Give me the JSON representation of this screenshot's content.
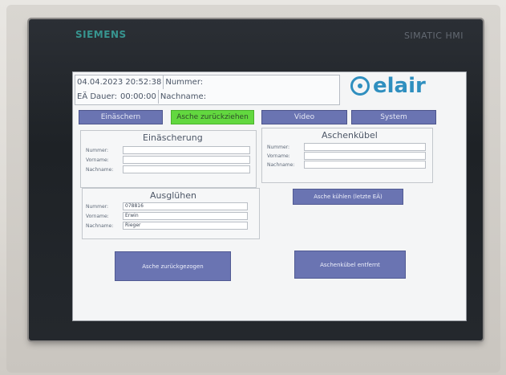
{
  "hmi": {
    "brand_left": "SIEMENS",
    "brand_right": "SIMATIC HMI",
    "screen": {
      "header": {
        "datetime": "04.04.2023 20:52:38",
        "number_label": "Nummer:",
        "ea_label": "EÄ Dauer:",
        "duration": "00:00:00",
        "name_label": "Nachname:"
      },
      "logo_text": "elair",
      "tabs": [
        {
          "label": "Einäschern"
        },
        {
          "label": "Asche zurückziehen"
        },
        {
          "label": "Video"
        },
        {
          "label": "System"
        }
      ],
      "einaescherung": {
        "title": "Einäscherung",
        "labels": {
          "nummer": "Nummer:",
          "vorname": "Vorname:",
          "nachname": "Nachname:"
        }
      },
      "aschenkuebel": {
        "title": "Aschenkübel",
        "labels": {
          "nummer": "Nummer:",
          "vorname": "Vorname:",
          "nachname": "Nachname:"
        }
      },
      "ausgluehen": {
        "title": "Ausglühen",
        "labels": {
          "nummer": "Nummer:",
          "vorname": "Vorname:",
          "nachname": "Nachname:"
        },
        "values": {
          "nummer": "078816",
          "vorname": "Erwin",
          "nachname": "Rieger"
        }
      },
      "buttons": {
        "cool_ashes": "Asche kühlen (letzte EÄ)",
        "ashes_retracted": "Asche zurückgezogen",
        "bin_removed": "Aschenkübel entfernt"
      }
    }
  }
}
